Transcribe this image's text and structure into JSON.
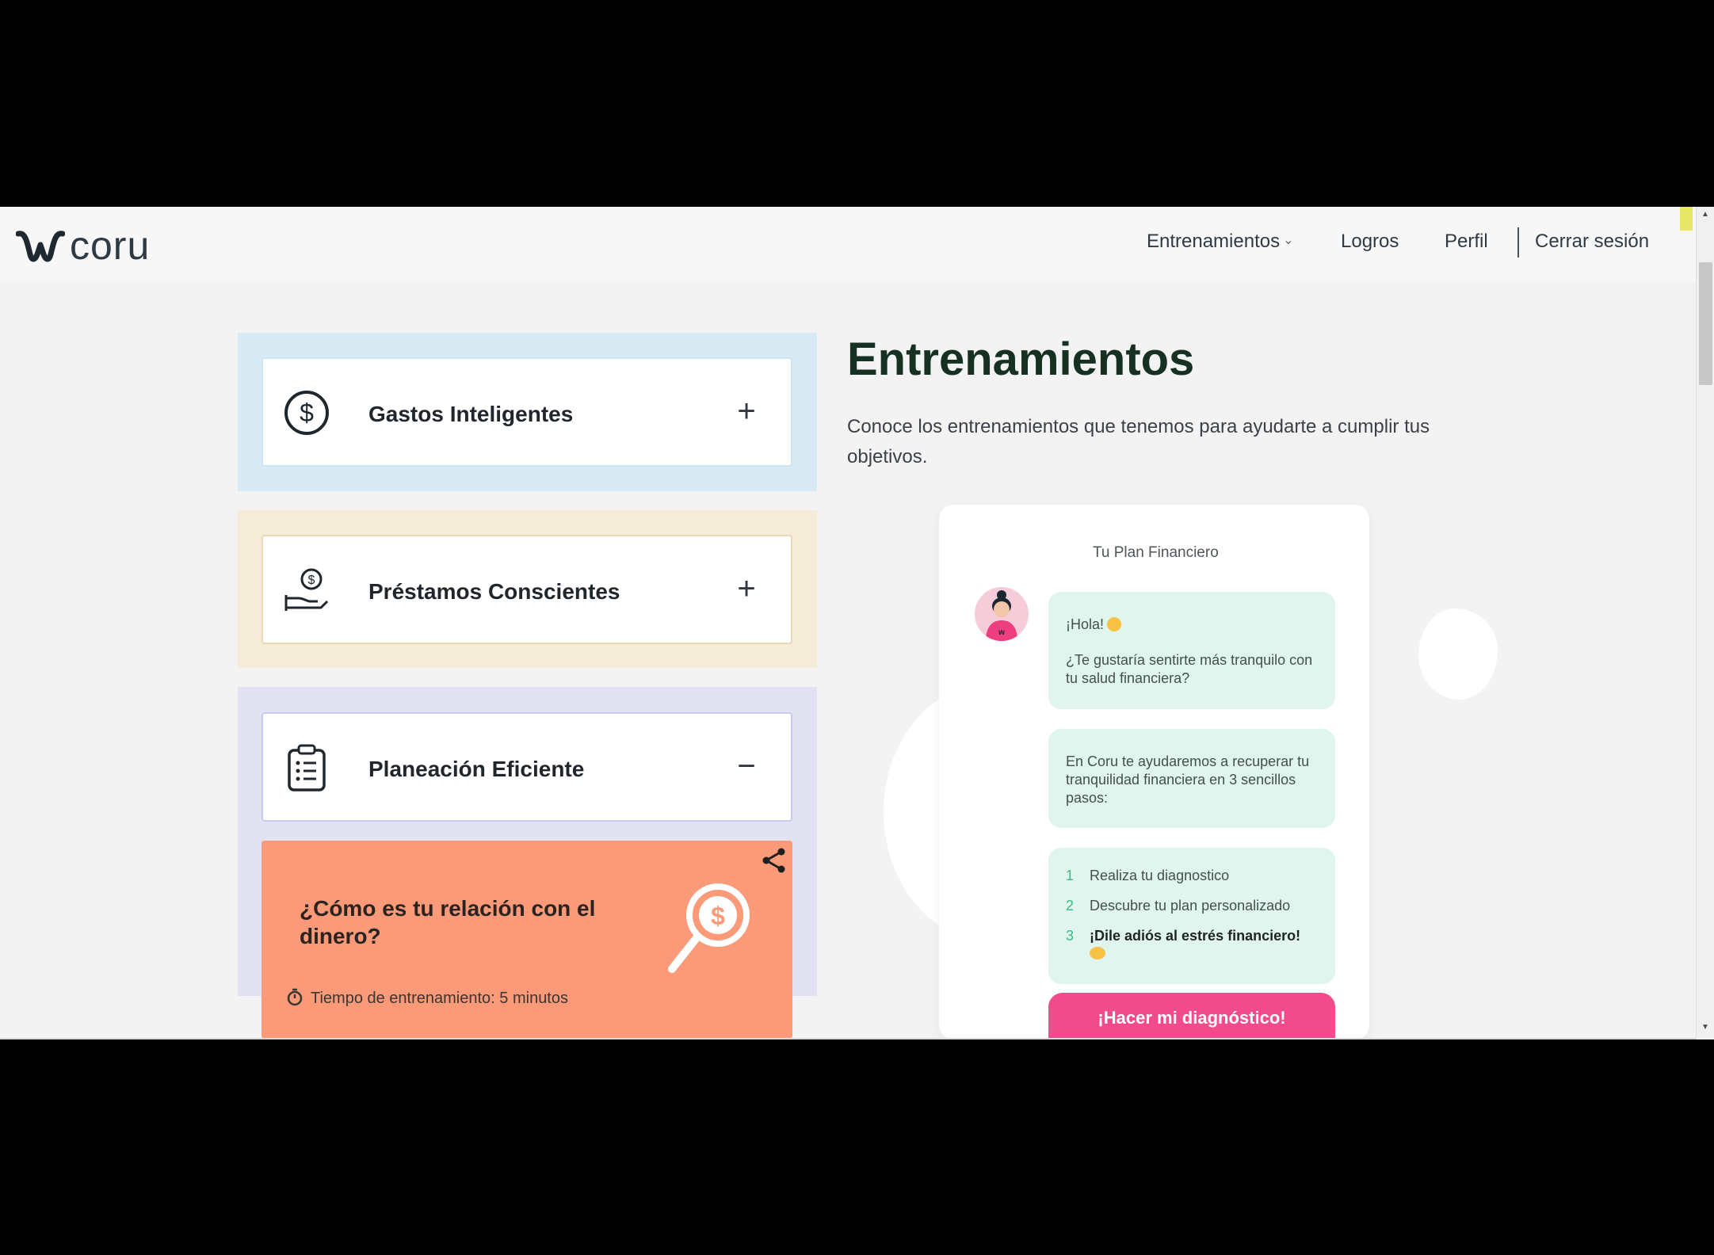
{
  "header": {
    "brand": "coru",
    "nav": {
      "trainings": "Entrenamientos",
      "logros": "Logros",
      "perfil": "Perfil",
      "logout": "Cerrar sesión"
    }
  },
  "categories": [
    {
      "title": "Gastos Inteligentes",
      "toggle": "+",
      "icon": "dollar-coin-icon"
    },
    {
      "title": "Préstamos Conscientes",
      "toggle": "+",
      "icon": "hand-coin-icon"
    },
    {
      "title": "Planeación Eficiente",
      "toggle": "−",
      "icon": "clipboard-list-icon"
    }
  ],
  "training": {
    "title": "¿Cómo es tu relación con el dinero?",
    "time_label": "Tiempo de entrenamiento: 5 minutos",
    "icons": [
      "share-icon",
      "magnifier-dollar-icon",
      "stopwatch-icon"
    ]
  },
  "hero": {
    "title": "Entrenamientos",
    "intro": "Conoce los entrenamientos que tenemos para ayudarte a cumplir tus objetivos."
  },
  "phone": {
    "title": "Tu Plan Financiero",
    "greeting": "¡Hola!",
    "question": "¿Te gustaría sentirte más tranquilo con tu salud financiera?",
    "explain": "En Coru te ayudaremos a recuperar tu tranquilidad financiera en 3 sencillos pasos:",
    "steps": [
      {
        "num": "1",
        "text": "Realiza tu diagnostico"
      },
      {
        "num": "2",
        "text": "Descubre tu plan personalizado"
      },
      {
        "num": "3",
        "text": "¡Dile adiós al estrés financiero!"
      }
    ],
    "cta": "¡Hacer mi diagnóstico!"
  },
  "colors": {
    "cta": "#f14b8c",
    "training_card": "#fa9a78",
    "heading": "#163022",
    "bubble": "#dff5ee"
  }
}
